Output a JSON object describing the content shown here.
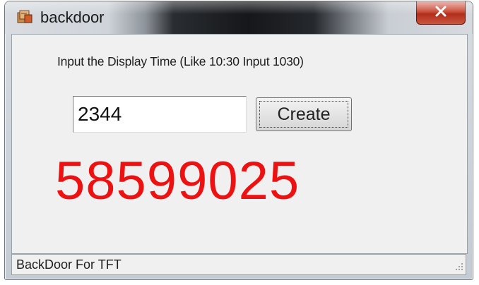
{
  "window": {
    "title": "backdoor",
    "close_glyph": "X"
  },
  "main": {
    "instruction": "Input the Display Time (Like 10:30 Input 1030)",
    "time_input_value": "2344",
    "create_label": "Create",
    "generated_code": "58599025",
    "code_color": "#ee1111"
  },
  "statusbar": {
    "text": "BackDoor For TFT"
  },
  "icons": {
    "app": "app-icon",
    "close": "close-icon",
    "grip": "resize-grip-icon"
  }
}
